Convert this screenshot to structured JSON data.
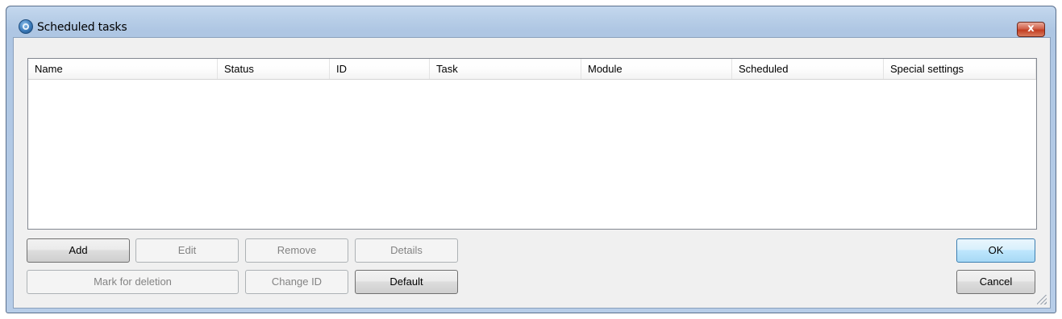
{
  "window": {
    "title": "Scheduled tasks",
    "close_label": "x"
  },
  "table": {
    "columns": [
      "Name",
      "Status",
      "ID",
      "Task",
      "Module",
      "Scheduled",
      "Special settings"
    ],
    "rows": []
  },
  "buttons": {
    "add": "Add",
    "edit": "Edit",
    "remove": "Remove",
    "details": "Details",
    "mark_for_deletion": "Mark for deletion",
    "change_id": "Change ID",
    "default": "Default",
    "ok": "OK",
    "cancel": "Cancel"
  },
  "icons": {
    "app": "scheduled-tasks-icon",
    "close": "close-icon",
    "grip": "resize-grip-icon"
  },
  "colors": {
    "title_bar": "#b9cfe8",
    "close_button": "#c23d22",
    "primary_button": "#bee6fd"
  }
}
